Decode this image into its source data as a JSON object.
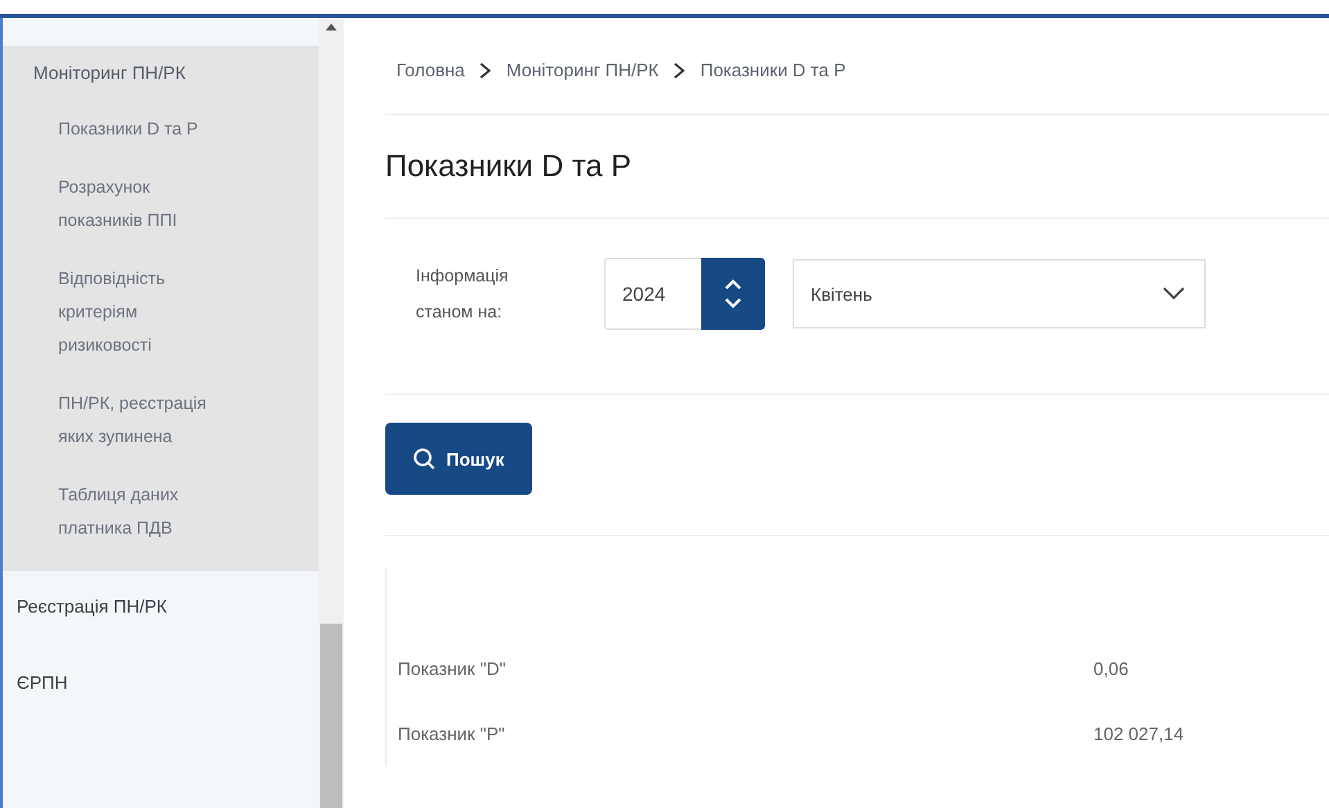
{
  "sidebar": {
    "items": [
      {
        "label": "Моніторинг ПН/РК",
        "expanded": true,
        "children": [
          {
            "label": "Показники D та P"
          },
          {
            "label": "Розрахунок показників ППІ"
          },
          {
            "label": "Відповідність критеріям ризиковості"
          },
          {
            "label": "ПН/РК, реєстрація яких зупинена"
          },
          {
            "label": "Таблиця даних платника ПДВ"
          }
        ]
      },
      {
        "label": "Реєстрація ПН/РК",
        "expanded": false
      },
      {
        "label": "ЄРПН",
        "expanded": false
      }
    ]
  },
  "breadcrumb": [
    "Головна",
    "Моніторинг ПН/РК",
    "Показники D та P"
  ],
  "title": "Показники D та P",
  "filter": {
    "label": "Інформація станом на:",
    "year": "2024",
    "month": "Квітень"
  },
  "search_button": "Пошук",
  "results": [
    {
      "name": "Показник \"D\"",
      "value": "0,06"
    },
    {
      "name": "Показник \"P\"",
      "value": "102 027,14"
    }
  ]
}
